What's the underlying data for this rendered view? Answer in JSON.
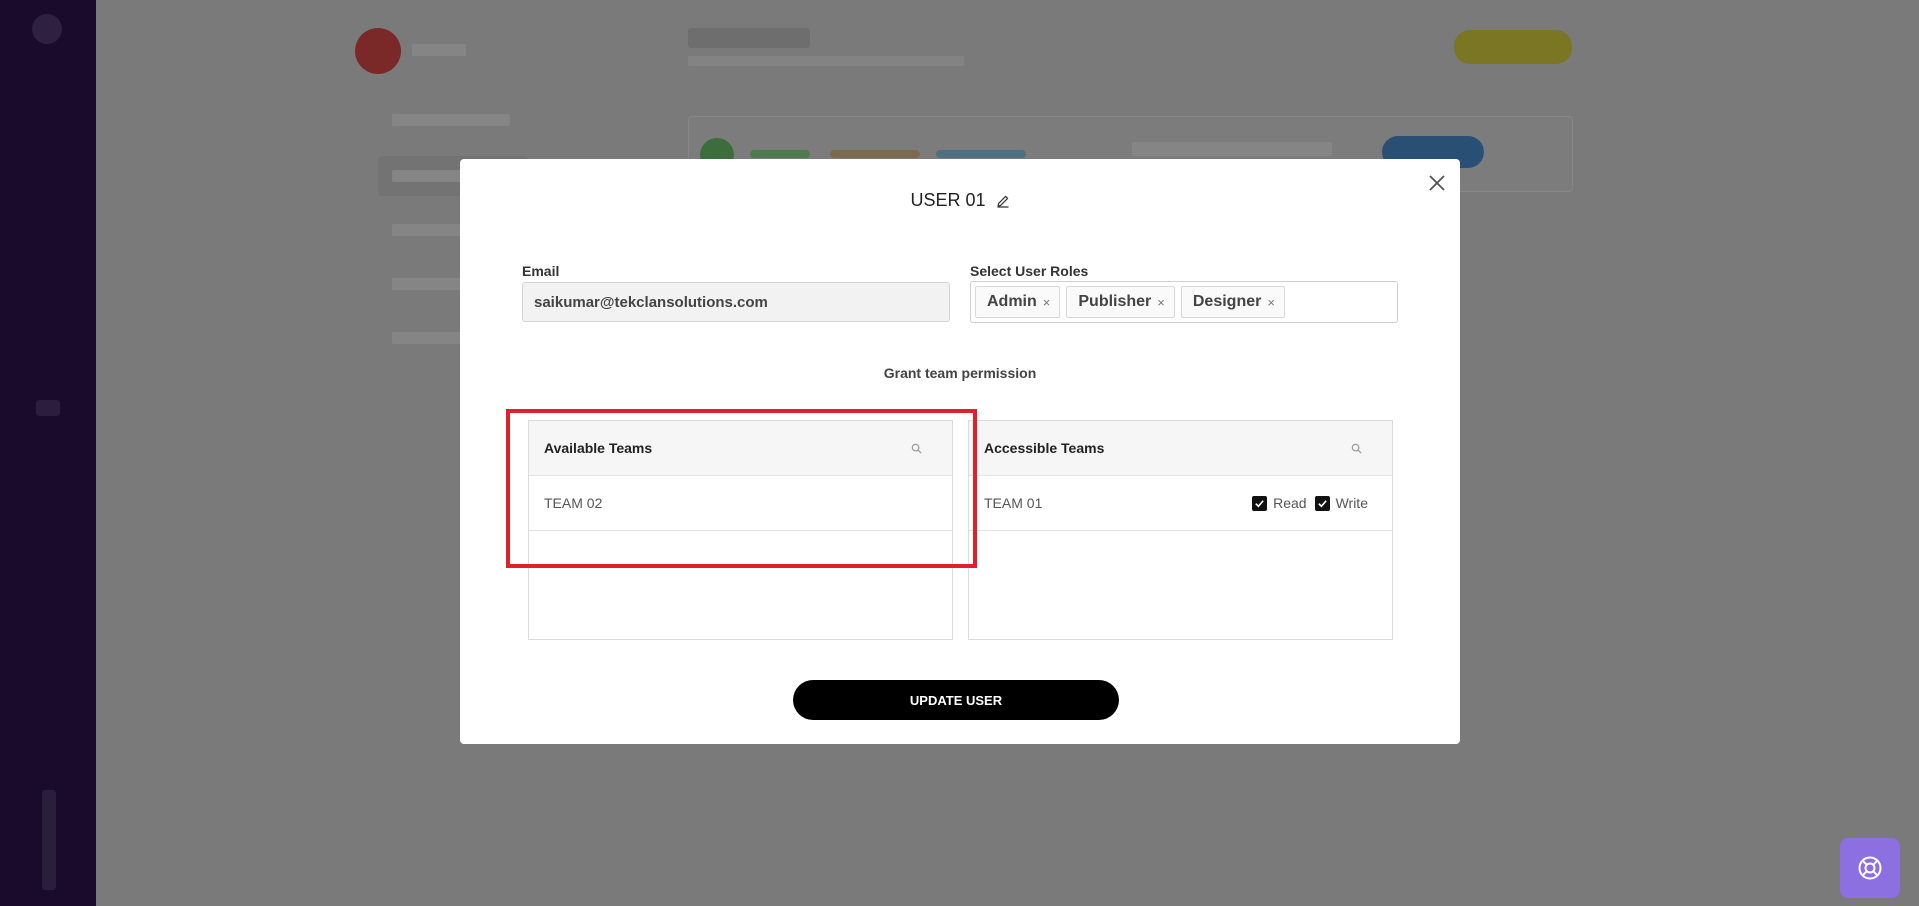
{
  "modal": {
    "title": "USER 01",
    "email_label": "Email",
    "email_value": "saikumar@tekclansolutions.com",
    "roles_label": "Select User Roles",
    "roles": [
      {
        "label": "Admin",
        "remove": "×"
      },
      {
        "label": "Publisher",
        "remove": "×"
      },
      {
        "label": "Designer",
        "remove": "×"
      }
    ],
    "grant_label": "Grant team permission",
    "available": {
      "header": "Available Teams",
      "teams": [
        "TEAM 02"
      ]
    },
    "accessible": {
      "header": "Accessible Teams",
      "teams": [
        {
          "name": "TEAM 01",
          "read_label": "Read",
          "write_label": "Write",
          "read": true,
          "write": true
        }
      ]
    },
    "update_label": "UPDATE USER"
  },
  "colors": {
    "overlay": "#7a7a7a",
    "sidebar": "#1a0a2b",
    "highlight": "#e0202b",
    "help_widget": "#8c6fe0",
    "primary_button": "#000000"
  },
  "icons": {
    "close": "close-icon",
    "edit": "pencil-icon",
    "search": "search-icon",
    "check": "check-icon",
    "help": "lifebuoy-icon"
  }
}
